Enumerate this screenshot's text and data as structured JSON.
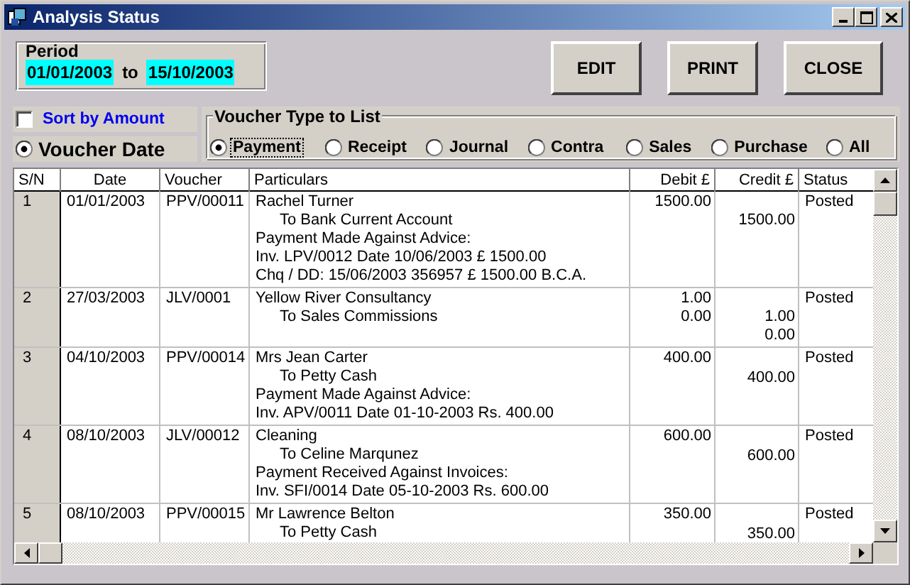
{
  "window": {
    "title": "Analysis Status"
  },
  "period": {
    "label": "Period",
    "from": "01/01/2003",
    "separator": "to",
    "to": "15/10/2003"
  },
  "buttons": [
    "EDIT",
    "PRINT",
    "CLOSE"
  ],
  "sort_options": [
    {
      "kind": "checkbox",
      "label": "Sort by Amount",
      "checked": false
    },
    {
      "kind": "radio",
      "label": "Voucher Date",
      "selected": true
    }
  ],
  "voucher_type": {
    "label": "Voucher Type to List",
    "options": [
      {
        "label": "Payment",
        "selected": true
      },
      {
        "label": "Receipt",
        "selected": false
      },
      {
        "label": "Journal",
        "selected": false
      },
      {
        "label": "Contra",
        "selected": false
      },
      {
        "label": "Sales",
        "selected": false
      },
      {
        "label": "Purchase",
        "selected": false
      },
      {
        "label": "All",
        "selected": false
      }
    ]
  },
  "table": {
    "columns": [
      "S/N",
      "Date",
      "Voucher",
      "Particulars",
      "Debit £",
      "Credit £",
      "Status"
    ],
    "rows": [
      {
        "sn": "1",
        "date": "01/01/2003",
        "voucher": "PPV/00011",
        "particulars": [
          {
            "kind": "name",
            "text": "Rachel Turner"
          },
          {
            "kind": "account",
            "text": "To  Bank Current Account"
          },
          {
            "kind": "name",
            "text": "Payment Made Against Advice:"
          },
          {
            "kind": "name",
            "text": "Inv. LPV/0012  Date 10/06/2003  £ 1500.00"
          },
          {
            "kind": "name",
            "text": "Chq / DD: 15/06/2003  356957  £ 1500.00  B.C.A."
          }
        ],
        "debit": [
          "1500.00"
        ],
        "credit": [
          "1500.00"
        ],
        "status": "Posted"
      },
      {
        "sn": "2",
        "date": "27/03/2003",
        "voucher": "JLV/0001",
        "particulars": [
          {
            "kind": "name",
            "text": "Yellow River Consultancy"
          },
          {
            "kind": "account",
            "text": "To  Sales Commissions"
          }
        ],
        "debit": [
          "1.00",
          "0.00"
        ],
        "credit": [
          "1.00",
          "0.00"
        ],
        "status": "Posted"
      },
      {
        "sn": "3",
        "date": "04/10/2003",
        "voucher": "PPV/00014",
        "particulars": [
          {
            "kind": "name",
            "text": "Mrs Jean Carter"
          },
          {
            "kind": "account",
            "text": "To  Petty Cash"
          },
          {
            "kind": "name",
            "text": "Payment Made Against Advice:"
          },
          {
            "kind": "name",
            "text": "Inv. APV/0011  Date 01-10-2003  Rs. 400.00"
          }
        ],
        "debit": [
          "400.00"
        ],
        "credit": [
          "400.00"
        ],
        "status": "Posted"
      },
      {
        "sn": "4",
        "date": "08/10/2003",
        "voucher": "JLV/00012",
        "particulars": [
          {
            "kind": "name",
            "text": "Cleaning"
          },
          {
            "kind": "account",
            "text": "To  Celine Marqunez"
          },
          {
            "kind": "name",
            "text": "Payment Received Against Invoices:"
          },
          {
            "kind": "name",
            "text": "Inv. SFI/0014  Date 05-10-2003  Rs. 600.00"
          }
        ],
        "debit": [
          "600.00"
        ],
        "credit": [
          "600.00"
        ],
        "status": "Posted"
      },
      {
        "sn": "5",
        "date": "08/10/2003",
        "voucher": "PPV/00015",
        "particulars": [
          {
            "kind": "name",
            "text": "Mr Lawrence Belton"
          },
          {
            "kind": "account",
            "text": "To  Petty Cash"
          }
        ],
        "debit": [
          "350.00"
        ],
        "credit": [
          "350.00"
        ],
        "status": "Posted"
      }
    ]
  }
}
